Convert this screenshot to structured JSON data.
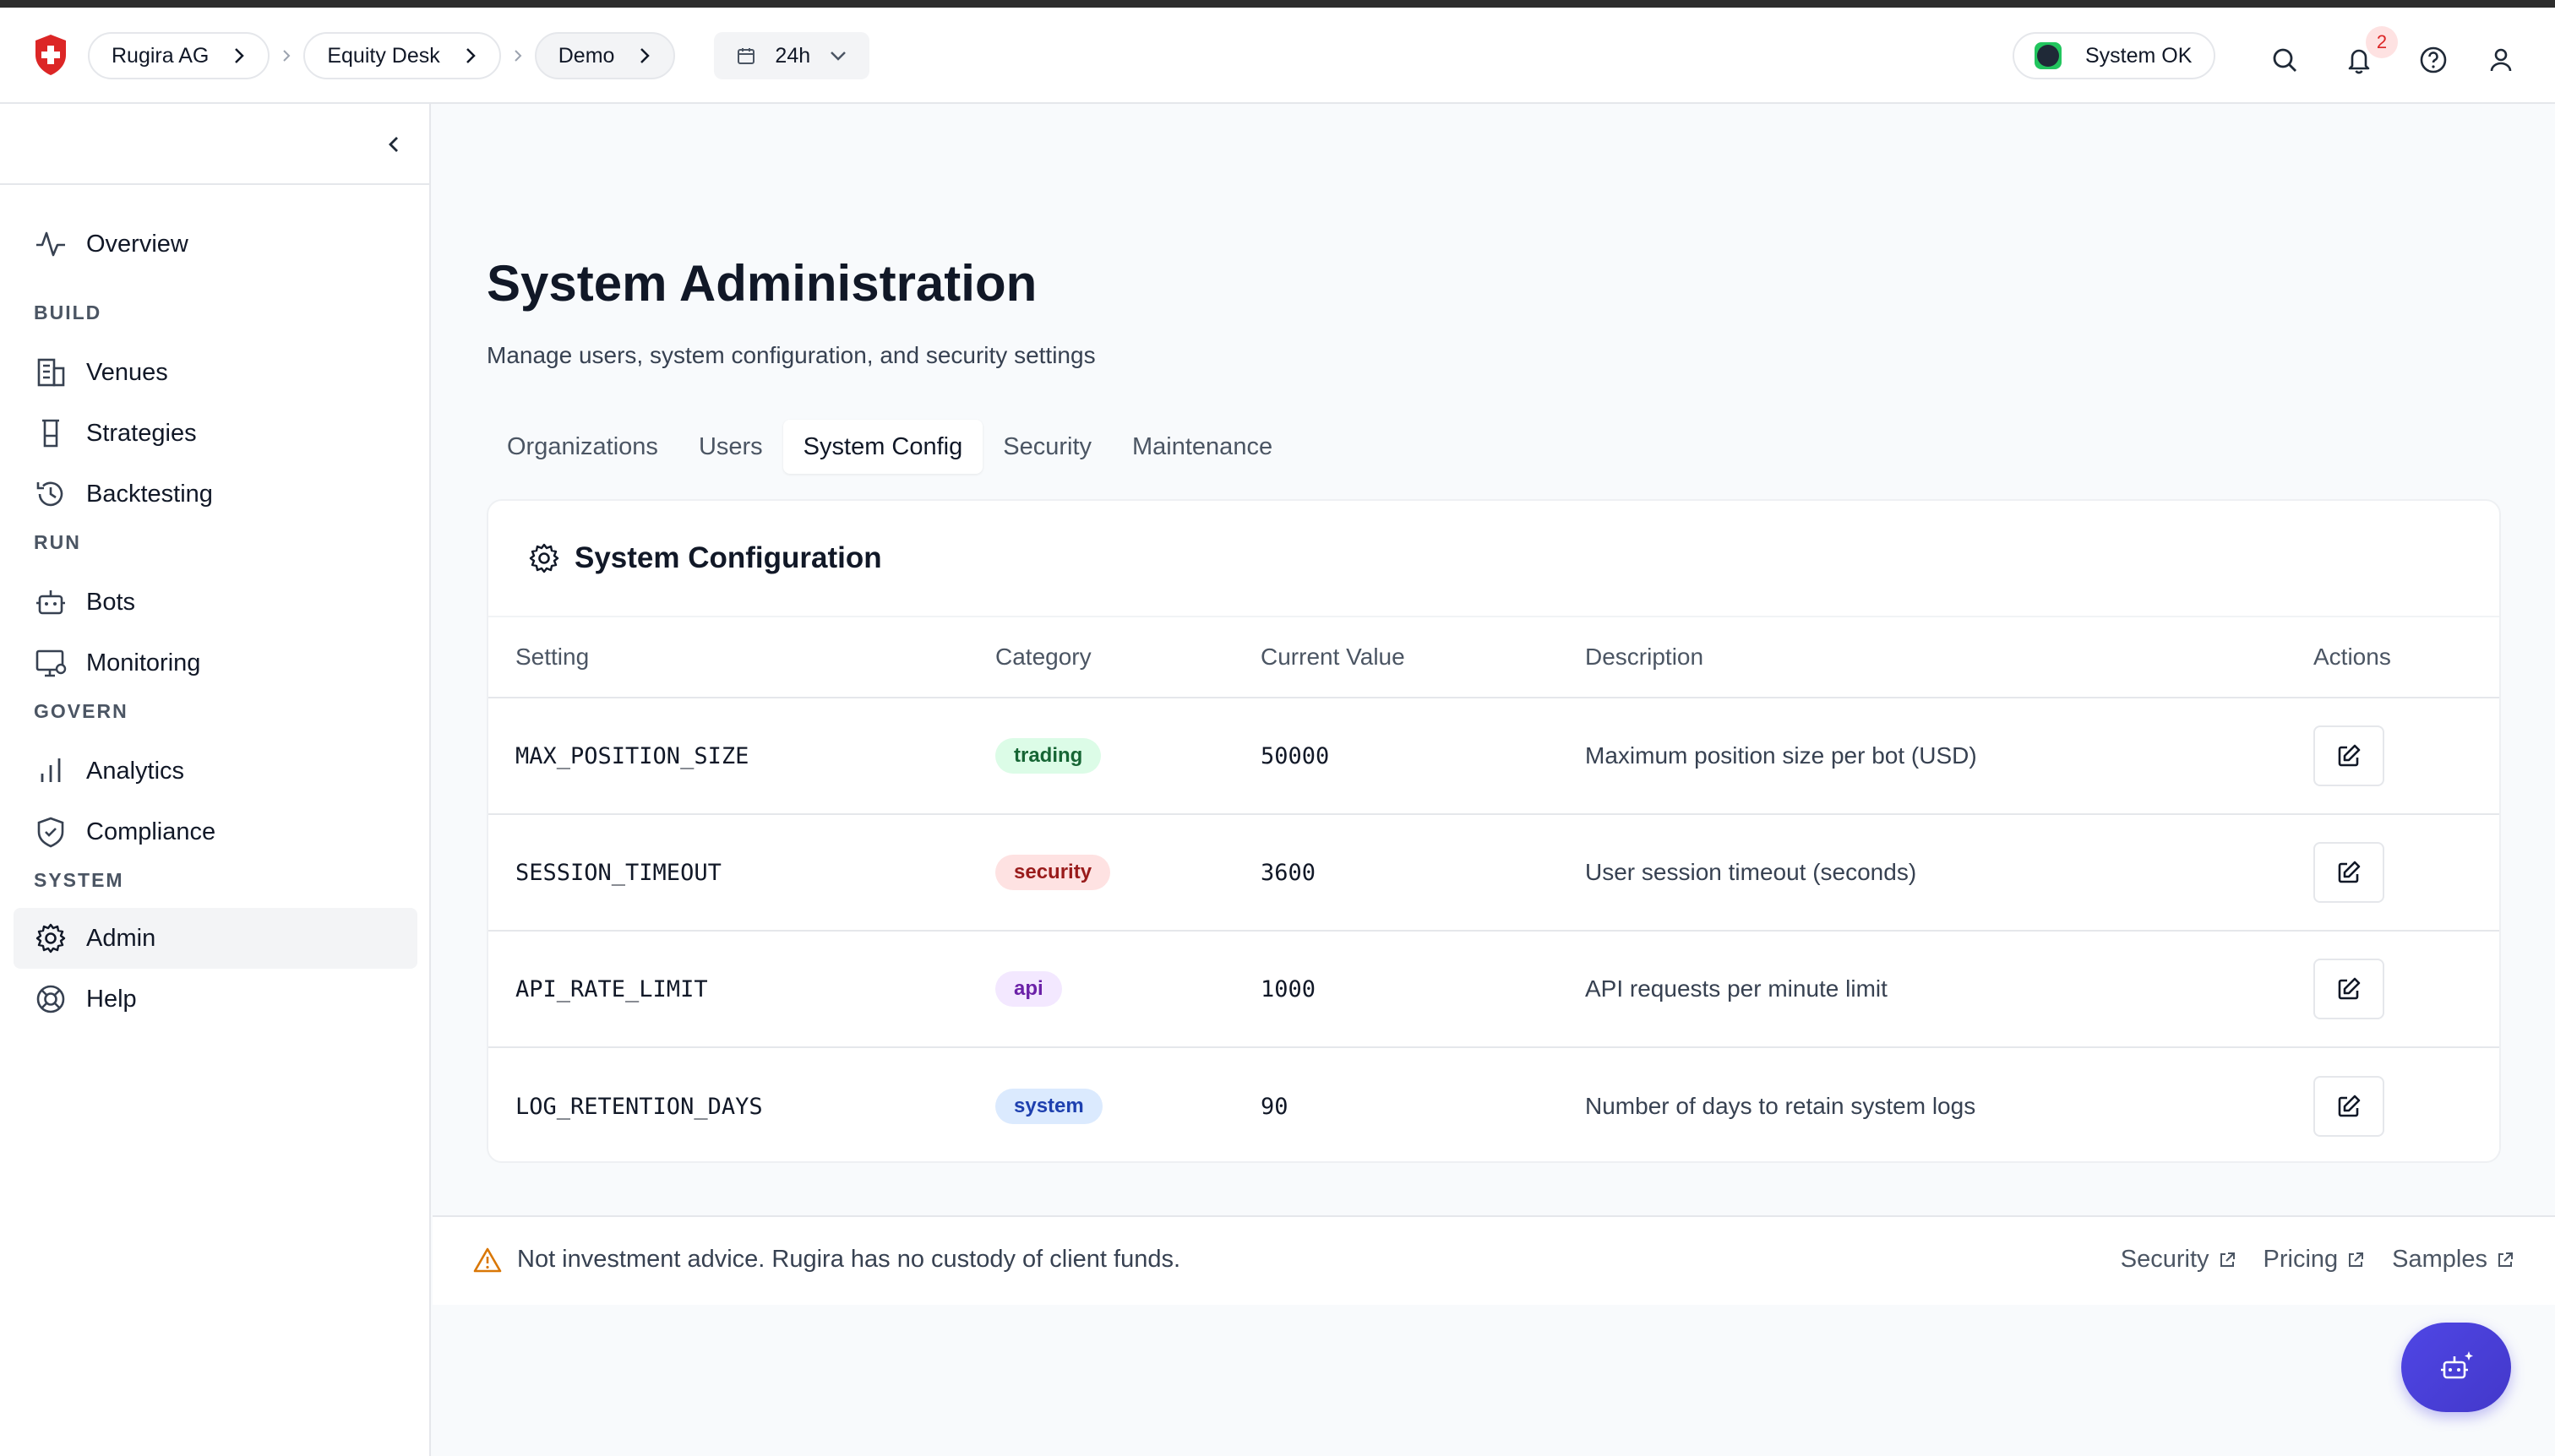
{
  "header": {
    "breadcrumbs": [
      "Rugira AG",
      "Equity Desk",
      "Demo"
    ],
    "time_range": "24h",
    "status": "System OK",
    "notification_count": "2"
  },
  "sidebar": {
    "items": [
      {
        "label": "Overview",
        "icon": "activity-icon"
      },
      {
        "section": "BUILD"
      },
      {
        "label": "Venues",
        "icon": "building-icon"
      },
      {
        "label": "Strategies",
        "icon": "flask-icon"
      },
      {
        "label": "Backtesting",
        "icon": "history-icon"
      },
      {
        "section": "RUN"
      },
      {
        "label": "Bots",
        "icon": "bot-icon"
      },
      {
        "label": "Monitoring",
        "icon": "monitor-icon"
      },
      {
        "section": "GOVERN"
      },
      {
        "label": "Analytics",
        "icon": "bar-chart-icon"
      },
      {
        "label": "Compliance",
        "icon": "shield-check-icon"
      },
      {
        "section": "SYSTEM"
      },
      {
        "label": "Admin",
        "icon": "gear-icon",
        "active": true
      },
      {
        "label": "Help",
        "icon": "lifebuoy-icon"
      }
    ]
  },
  "page": {
    "title": "System Administration",
    "subtitle": "Manage users, system configuration, and security settings",
    "tabs": [
      "Organizations",
      "Users",
      "System Config",
      "Security",
      "Maintenance"
    ],
    "active_tab": "System Config"
  },
  "config_card": {
    "title": "System Configuration",
    "columns": [
      "Setting",
      "Category",
      "Current Value",
      "Description",
      "Actions"
    ],
    "rows": [
      {
        "setting": "MAX_POSITION_SIZE",
        "category": "trading",
        "value": "50000",
        "description": "Maximum position size per bot (USD)"
      },
      {
        "setting": "SESSION_TIMEOUT",
        "category": "security",
        "value": "3600",
        "description": "User session timeout (seconds)"
      },
      {
        "setting": "API_RATE_LIMIT",
        "category": "api",
        "value": "1000",
        "description": "API requests per minute limit"
      },
      {
        "setting": "LOG_RETENTION_DAYS",
        "category": "system",
        "value": "90",
        "description": "Number of days to retain system logs"
      }
    ]
  },
  "footer": {
    "note": "Not investment advice. Rugira has no custody of client funds.",
    "links": [
      "Security",
      "Pricing",
      "Samples"
    ]
  },
  "colors": {
    "brand_red": "#dc2626",
    "accent_indigo": "#4f46e5"
  }
}
